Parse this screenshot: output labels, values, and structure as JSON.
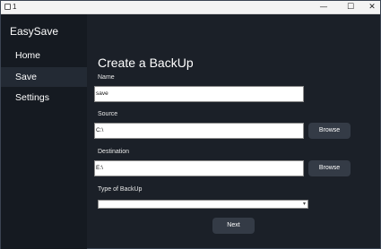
{
  "window": {
    "title": "1",
    "controls": {
      "minimize": "—",
      "maximize": "☐",
      "close": "✕"
    }
  },
  "sidebar": {
    "app_name": "EasySave",
    "items": [
      {
        "label": "Home"
      },
      {
        "label": "Save"
      },
      {
        "label": "Settings"
      }
    ]
  },
  "main": {
    "title": "Create a BackUp",
    "name_label": "Name",
    "name_value": "save",
    "source_label": "Source",
    "source_value": "C:\\",
    "destination_label": "Destination",
    "destination_value": "E:\\",
    "browse_label": "Browse",
    "type_label": "Type of BackUp",
    "type_value": "",
    "next_label": "Next"
  },
  "colors": {
    "background": "#1b2028",
    "sidebar": "#151a21",
    "selected_nav": "#232a34",
    "button": "#343b46",
    "text": "#ffffff"
  }
}
